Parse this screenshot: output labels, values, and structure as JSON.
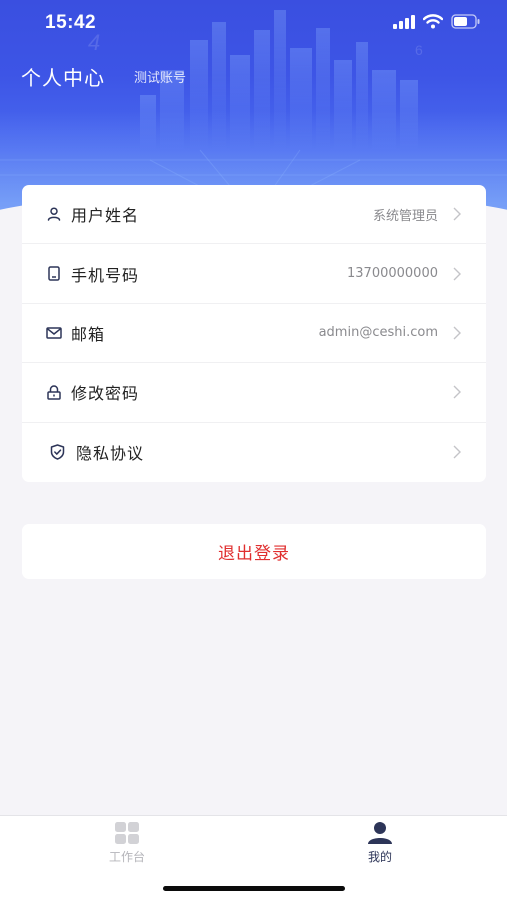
{
  "status_bar": {
    "time": "15:42"
  },
  "header": {
    "title": "个人中心",
    "subtitle": "测试账号"
  },
  "profile_rows": [
    {
      "label": "用户姓名",
      "value": "系统管理员",
      "icon": "user-icon"
    },
    {
      "label": "手机号码",
      "value": "13700000000",
      "icon": "phone-icon"
    },
    {
      "label": "邮箱",
      "value": "admin@ceshi.com",
      "icon": "mail-icon"
    },
    {
      "label": "修改密码",
      "value": "",
      "icon": "lock-icon"
    },
    {
      "label": "隐私协议",
      "value": "",
      "icon": "shield-icon"
    }
  ],
  "logout": {
    "label": "退出登录"
  },
  "tabbar": {
    "items": [
      {
        "label": "工作台",
        "icon": "grid-icon",
        "active": false
      },
      {
        "label": "我的",
        "icon": "person-icon",
        "active": true
      }
    ]
  },
  "colors": {
    "header_blue": "#3d55e6",
    "logout_red": "#e02e2e",
    "icon_navy": "#2d3558",
    "tab_inactive": "#b5b5ba"
  }
}
